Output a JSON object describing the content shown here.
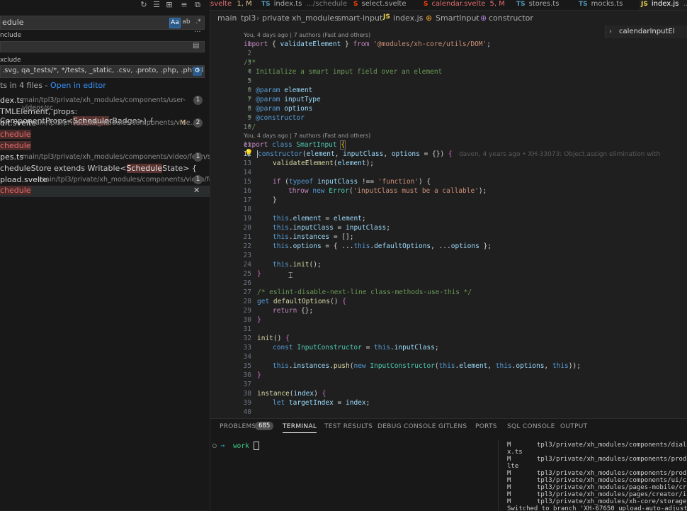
{
  "sidebar": {
    "search_value": "edule",
    "include_label": "nclude",
    "exclude_label": "xclude",
    "exclude_value": ".svg, qa_tests/*, */tests, _static, .csv, .proto, .php, .phtml",
    "options": [
      "Aa",
      "ab",
      ".*"
    ],
    "summary": "ts in 4 files -",
    "open_in_editor": "Open in editor",
    "results": [
      {
        "file": "dex.ts",
        "path": "main/tpl3/private/xh_modules/components/user-videos/sc...",
        "count": "1",
        "matches": [
          {
            "pre": "TMLElement, props: ComponentProps<",
            "hl": "Schedule",
            "post": "rBadge>) {"
          }
        ]
      },
      {
        "file": "dit.svelte",
        "path": "main/tpl3/private/xh_modules/components/vide...",
        "status": "M",
        "count": "2",
        "matches": [
          {
            "pre": "",
            "hl": "chedule",
            "post": ""
          },
          {
            "pre": "",
            "hl": "chedule",
            "post": ""
          }
        ]
      },
      {
        "file": "pes.ts",
        "path": "main/tpl3/private/xh_modules/components/video/form/sc...",
        "count": "1",
        "matches": [
          {
            "pre": "cheduleStore extends Writable<",
            "hl": "Schedule",
            "post": "State> {"
          }
        ]
      },
      {
        "file": "pload.svelte",
        "path": "main/tpl3/private/xh_modules/components/video/for...",
        "count": "1",
        "matches": [
          {
            "pre": "",
            "hl": "chedule",
            "post": ""
          }
        ]
      }
    ]
  },
  "tabs": [
    {
      "icon": "",
      "label": "svelte",
      "extra": "1, M",
      "color": "#e2c08d"
    },
    {
      "icon": "TS",
      "label": "index.ts",
      "extra": ".../schedule",
      "color": "#a8a8a8"
    },
    {
      "icon": "S",
      "label": "select.svelte",
      "extra": "",
      "color": "#a8a8a8"
    },
    {
      "icon": "S",
      "label": "calendar.svelte",
      "extra": "5, M",
      "color": "#e2c08d"
    },
    {
      "icon": "TS",
      "label": "stores.ts",
      "extra": "",
      "color": "#a8a8a8"
    },
    {
      "icon": "TS",
      "label": "mocks.ts",
      "extra": "",
      "color": "#a8a8a8"
    },
    {
      "icon": "JS",
      "label": "index.js",
      "extra": ".../",
      "color": "#ffffff"
    }
  ],
  "breadcrumbs": [
    "main",
    "tpl3",
    "private",
    "xh_modules",
    "smart-input",
    "index.js",
    "SmartInput",
    "constructor"
  ],
  "find_widget_value": "calendarInputEl",
  "codelens": {
    "top": "You, 4 days ago | 7 authors (Fast and others)",
    "class": "You, 4 days ago | 7 authors (Fast and others)"
  },
  "blame_line12": "daven, 4 years ago • XH-33073: Object.assign elimination with",
  "line_numbers": [
    "1",
    "2",
    "3",
    "4",
    "5",
    "6",
    "7",
    "8",
    "9",
    "10",
    "11",
    "12",
    "13",
    "14",
    "15",
    "16",
    "17",
    "18",
    "19",
    "20",
    "21",
    "22",
    "23",
    "24",
    "25",
    "26",
    "27",
    "28",
    "29",
    "30",
    "31",
    "32",
    "33",
    "34",
    "35",
    "36",
    "37",
    "38",
    "39",
    "40"
  ],
  "panel": {
    "tabs": [
      "PROBLEMS",
      "TERMINAL",
      "TEST RESULTS",
      "DEBUG CONSOLE",
      "GITLENS",
      "PORTS",
      "SQL CONSOLE",
      "OUTPUT"
    ],
    "problems_count": "685",
    "prompt_dir": "work",
    "git_lines": [
      {
        "s": "M",
        "p": "tpl3/private/xh_modules/components/dialog/"
      },
      {
        "s": "",
        "p": "x.ts"
      },
      {
        "s": "M",
        "p": "tpl3/private/xh_modules/components/produce"
      },
      {
        "s": "",
        "p": "lte"
      },
      {
        "s": "M",
        "p": "tpl3/private/xh_modules/components/produce"
      },
      {
        "s": "M",
        "p": "tpl3/private/xh_modules/components/ui/cont"
      },
      {
        "s": "M",
        "p": "tpl3/private/xh_modules/pages-mobile/creat"
      },
      {
        "s": "M",
        "p": "tpl3/private/xh_modules/pages/creator/inde"
      },
      {
        "s": "M",
        "p": "tpl3/private/xh_modules/xh-core/storage/er"
      },
      {
        "s": "",
        "p": "Switched to branch 'XH-67650_upload-auto-adjust'"
      }
    ]
  },
  "colors": {
    "accent": "#0078d4",
    "link": "#3794ff",
    "match_bg": "#5a3330"
  }
}
